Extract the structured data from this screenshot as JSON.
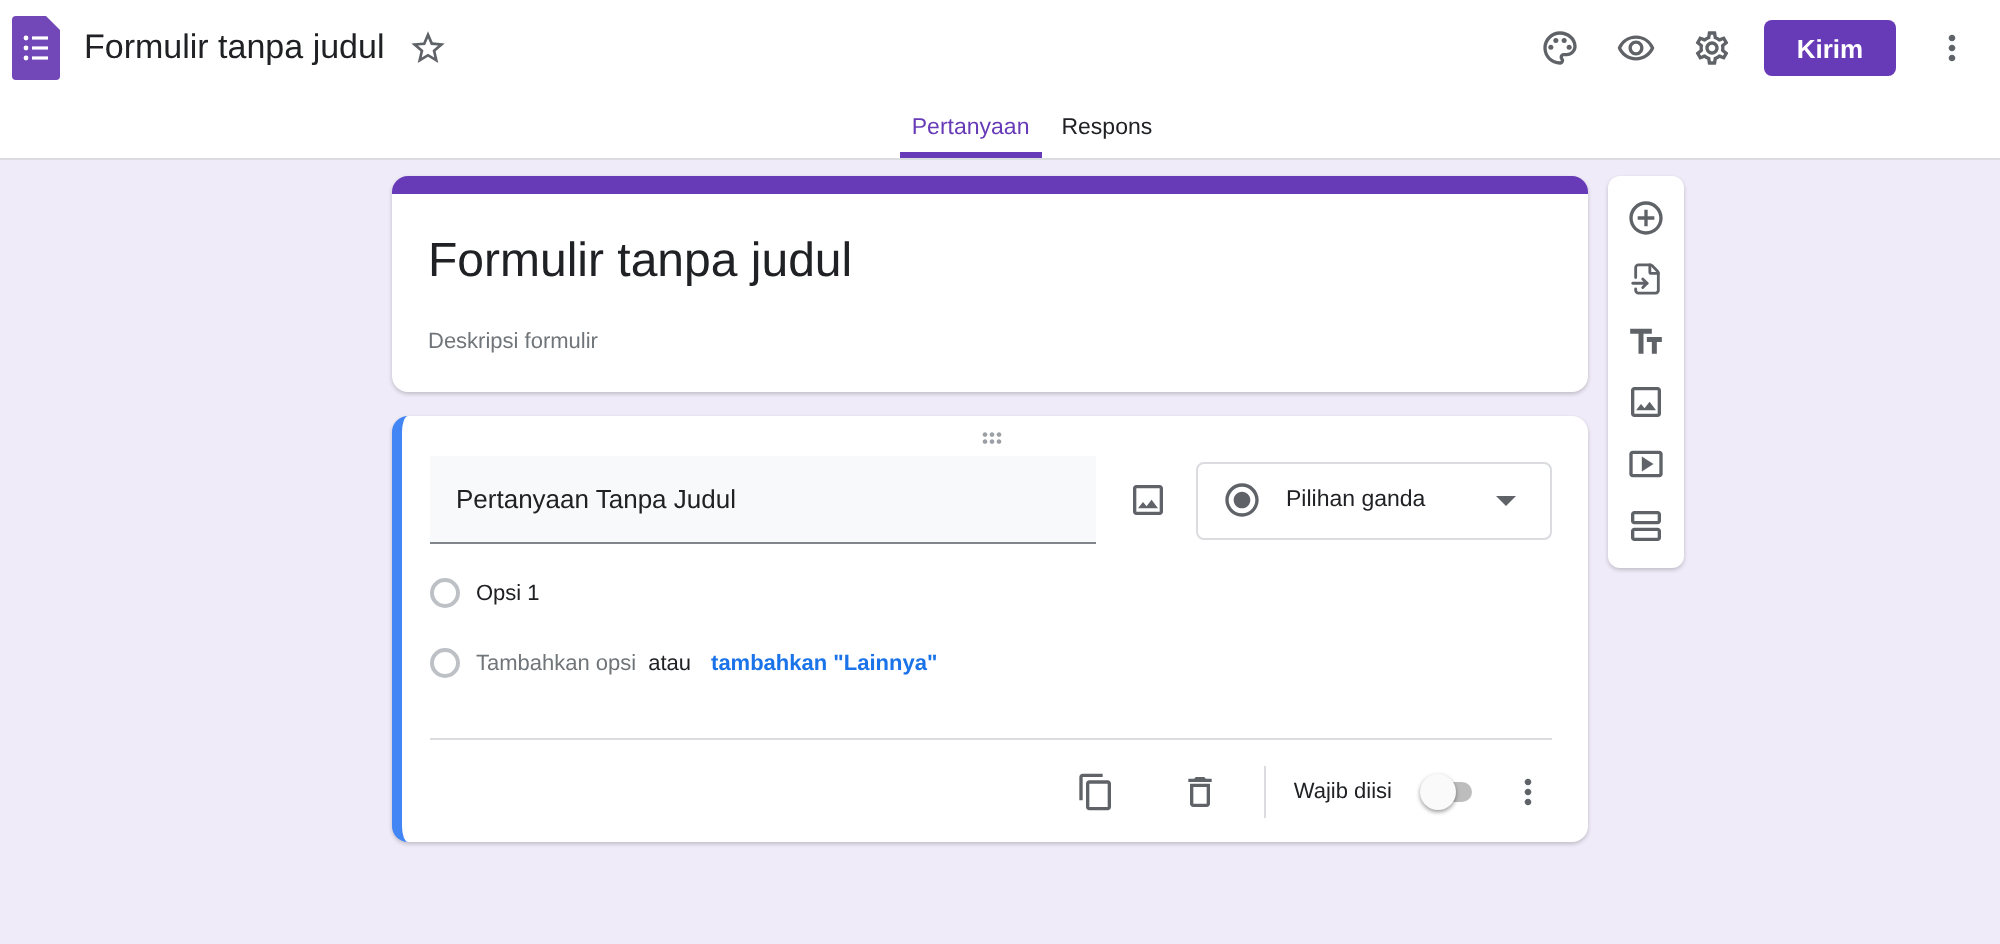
{
  "header": {
    "title": "Formulir tanpa judul",
    "send_button": "Kirim",
    "starred": false
  },
  "tabs": [
    {
      "label": "Pertanyaan",
      "selected": true
    },
    {
      "label": "Respons",
      "selected": false
    }
  ],
  "form": {
    "title": "Formulir tanpa judul",
    "description_placeholder": "Deskripsi formulir"
  },
  "question": {
    "title": "Pertanyaan Tanpa Judul",
    "type": "Pilihan ganda",
    "options": [
      {
        "label": "Opsi 1",
        "selected": false
      }
    ],
    "add_option": "Tambahkan opsi",
    "add_option_selected": false,
    "or": "atau",
    "add_other": "tambahkan \"Lainnya\"",
    "required_label": "Wajib diisi",
    "required": false
  }
}
